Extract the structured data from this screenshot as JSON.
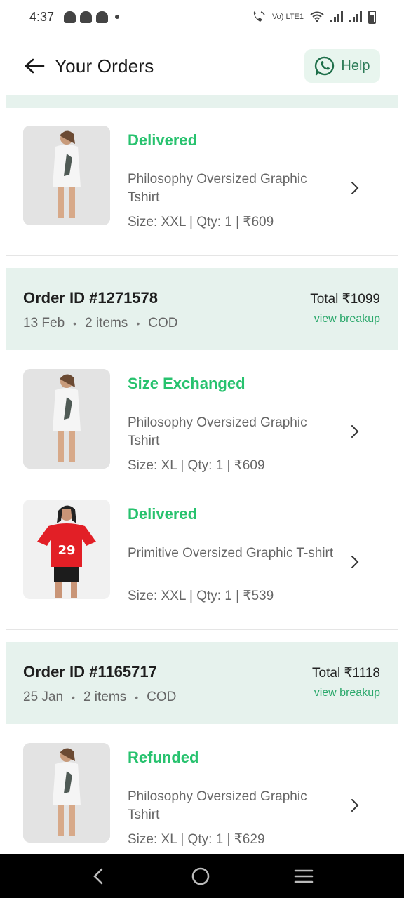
{
  "status_bar": {
    "time": "4:37",
    "network_label": "Vo) LTE1",
    "icons": [
      "snapchat-icon",
      "snapchat-icon",
      "snapchat-icon",
      "notification-dot-icon",
      "wifi-calling-icon",
      "wifi-icon",
      "signal-icon",
      "signal-icon",
      "battery-icon"
    ]
  },
  "header": {
    "title": "Your Orders",
    "help_label": "Help",
    "back_icon": "arrow-left-icon",
    "help_icon": "whatsapp-icon"
  },
  "colors": {
    "accent_green": "#27c26e",
    "band_bg": "#e6f2ed",
    "link_green": "#2aa86b"
  },
  "orders": [
    {
      "items": [
        {
          "status": "Delivered",
          "name": "Philosophy Oversized Graphic Tshirt",
          "meta": "Size: XXL  |  Qty: 1  |  ₹609"
        }
      ]
    },
    {
      "order_id": "Order ID #1271578",
      "total": "Total ₹1099",
      "date": "13 Feb",
      "count": "2 items",
      "payment": "COD",
      "breakup_label": "view breakup",
      "items": [
        {
          "status": "Size Exchanged",
          "name": "Philosophy Oversized Graphic Tshirt",
          "meta": "Size: XL  |  Qty: 1  |  ₹609"
        },
        {
          "status": "Delivered",
          "name": "Primitive Oversized Graphic T-shirt",
          "meta": "Size: XXL  |  Qty: 1  |  ₹539"
        }
      ]
    },
    {
      "order_id": "Order ID #1165717",
      "total": "Total ₹1118",
      "date": "25 Jan",
      "count": "2 items",
      "payment": "COD",
      "breakup_label": "view breakup",
      "items": [
        {
          "status": "Refunded",
          "name": "Philosophy Oversized Graphic Tshirt",
          "meta": "Size: XL  |  Qty: 1  |  ₹629"
        }
      ]
    }
  ],
  "nav": {
    "icons": [
      "back-nav-icon",
      "home-nav-icon",
      "recents-nav-icon"
    ]
  }
}
